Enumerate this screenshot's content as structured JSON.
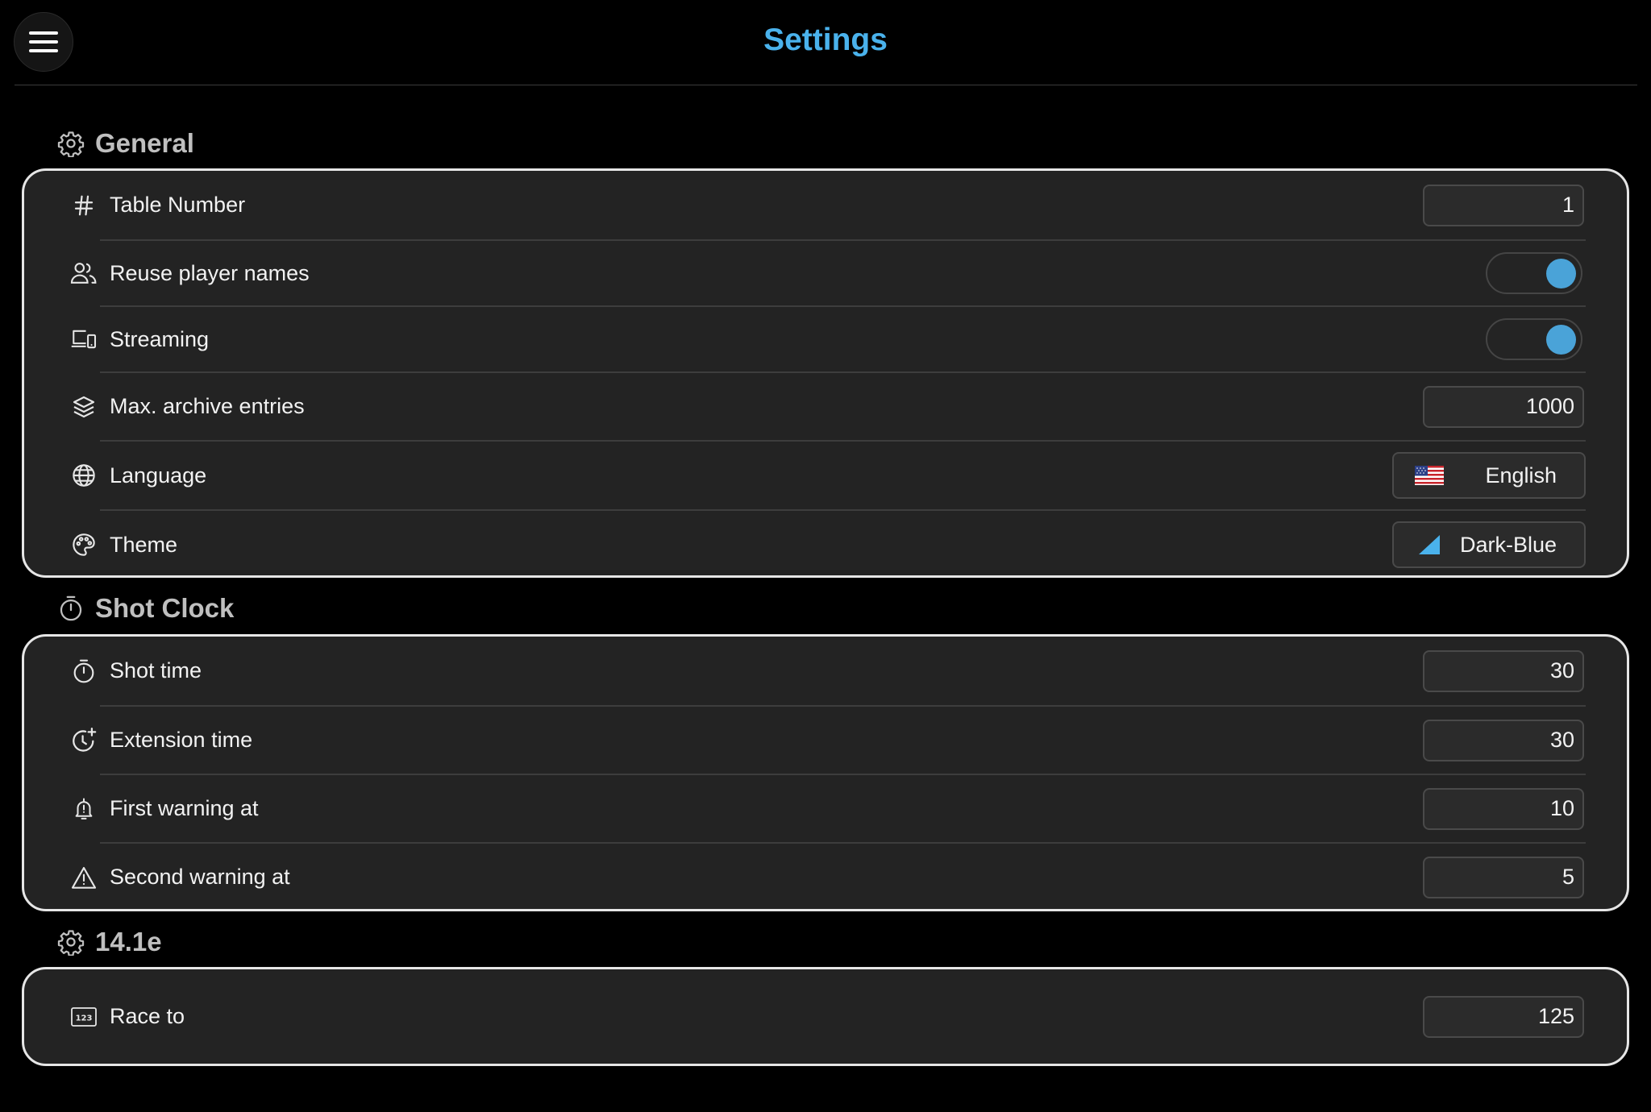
{
  "header": {
    "title": "Settings",
    "menu_icon": "hamburger-menu-icon"
  },
  "colors": {
    "accent": "#4ab2ec",
    "toggle_on": "#4aa3d8",
    "card_bg": "#232323",
    "card_border": "#e6e6e6",
    "background": "#000000"
  },
  "sections": {
    "general": {
      "title": "General",
      "icon": "gear-icon",
      "rows": {
        "table_number": {
          "label": "Table Number",
          "icon": "hash-icon",
          "value": "1"
        },
        "reuse_player_names": {
          "label": "Reuse player names",
          "icon": "users-icon",
          "toggle_on": true
        },
        "streaming": {
          "label": "Streaming",
          "icon": "devices-icon",
          "toggle_on": true
        },
        "max_archive_entries": {
          "label": "Max. archive entries",
          "icon": "layers-icon",
          "value": "1000"
        },
        "language": {
          "label": "Language",
          "icon": "globe-icon",
          "value": "English",
          "value_icon": "us-flag-icon"
        },
        "theme": {
          "label": "Theme",
          "icon": "palette-icon",
          "value": "Dark-Blue",
          "value_icon": "theme-swatch-icon"
        }
      }
    },
    "shot_clock": {
      "title": "Shot Clock",
      "icon": "stopwatch-icon",
      "rows": {
        "shot_time": {
          "label": "Shot time",
          "icon": "stopwatch-icon",
          "value": "30"
        },
        "extension_time": {
          "label": "Extension time",
          "icon": "clock-plus-icon",
          "value": "30"
        },
        "first_warning": {
          "label": "First warning at",
          "icon": "bell-alert-icon",
          "value": "10"
        },
        "second_warning": {
          "label": "Second warning at",
          "icon": "warning-triangle-icon",
          "value": "5"
        }
      }
    },
    "straight_pool": {
      "title": "14.1e",
      "icon": "gear-icon",
      "rows": {
        "race_to": {
          "label": "Race to",
          "icon": "numeric-123-icon",
          "value": "125"
        }
      }
    }
  }
}
